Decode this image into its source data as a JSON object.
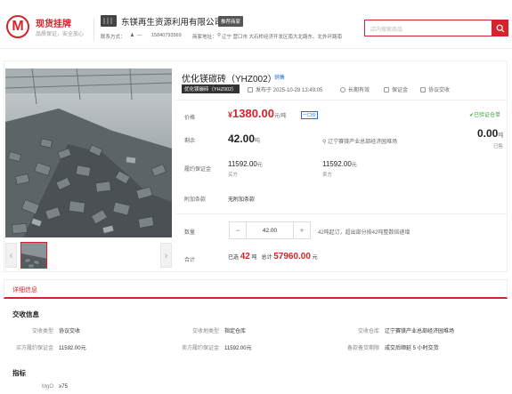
{
  "header": {
    "brand": "现货挂牌",
    "slogan": "品质保证，安全放心",
    "logo_letter": "M",
    "company": "东镁再生资源利用有限公司",
    "company_badge": "推荐商家",
    "contact_label": "联系方式：",
    "contact_person": "—",
    "phone": "15840793569",
    "address_label": "商家地址：",
    "address": "辽宁 营口市 大石桥经济开发区南大北路东、北外环路南",
    "search_placeholder": "店内搜索商品"
  },
  "product": {
    "title": "优化镁碳砖（YHZ002）",
    "status_tag": "销售",
    "category": "优化镁碳砖（YHZ002）",
    "published": "发布于 2025-10-28 13:49:05",
    "validity": "长期有效",
    "guarantee": "保证金",
    "delivery": "协议交收"
  },
  "pricing": {
    "price_label": "价格",
    "currency": "¥",
    "price": "1380.00",
    "price_unit": "元/吨",
    "one_price": "一口价",
    "certified": "已验证仓单",
    "remaining_label": "剩余",
    "remaining": "42.00",
    "remaining_unit": "吨",
    "location": "辽宁赛镁产业总部经济园堆场",
    "sold": "0.00",
    "sold_unit": "吨",
    "sold_label": "已售",
    "deposit_label": "履约保证金",
    "buyer_deposit": "11592.00",
    "buyer_deposit_unit": "元",
    "buyer_label": "买方",
    "seller_deposit": "11592.00",
    "seller_deposit_unit": "元",
    "seller_label": "卖方",
    "extra_label": "附加条款",
    "extra": "无附加条款",
    "qty_label": "数量",
    "qty": "42.00",
    "qty_note": "42吨起订，超出部分按42吨整数倍递增",
    "total_label": "合计",
    "selected_prefix": "已选",
    "selected_qty": "42",
    "selected_unit": "吨",
    "total_prefix": "总计",
    "total": "57960.00",
    "total_unit": "元"
  },
  "detail": {
    "tab": "详细信息",
    "delivery_title": "交收信息",
    "delivery_type_label": "交收类型",
    "delivery_type": "协议交收",
    "delivery_place_label": "交收地类型",
    "delivery_place": "指定仓库",
    "warehouse_label": "交收仓库",
    "warehouse": "辽宁赛镁产业总部经济园堆场",
    "buyer_deposit_label": "买方履约保证金",
    "buyer_deposit": "11592.00元",
    "seller_deposit_label": "卖方履约保证金",
    "seller_deposit": "11592.00元",
    "delivery_period_label": "备款备货期限",
    "delivery_period": "成交后顺延 5 小时交货",
    "spec_title": "指标",
    "mgo_label": "MgO",
    "mgo": "≥75"
  },
  "colors": {
    "accent": "#d5242b",
    "link": "#1e6fd9",
    "certified": "#3a9d3a"
  },
  "icons": [
    "logo-icon",
    "shop-icon",
    "person-icon",
    "location-icon",
    "search-icon",
    "calendar-icon",
    "clock-icon",
    "shield-icon",
    "handshake-icon",
    "check-circle-icon",
    "chevron-left-icon",
    "chevron-right-icon",
    "minus-icon",
    "plus-icon"
  ]
}
